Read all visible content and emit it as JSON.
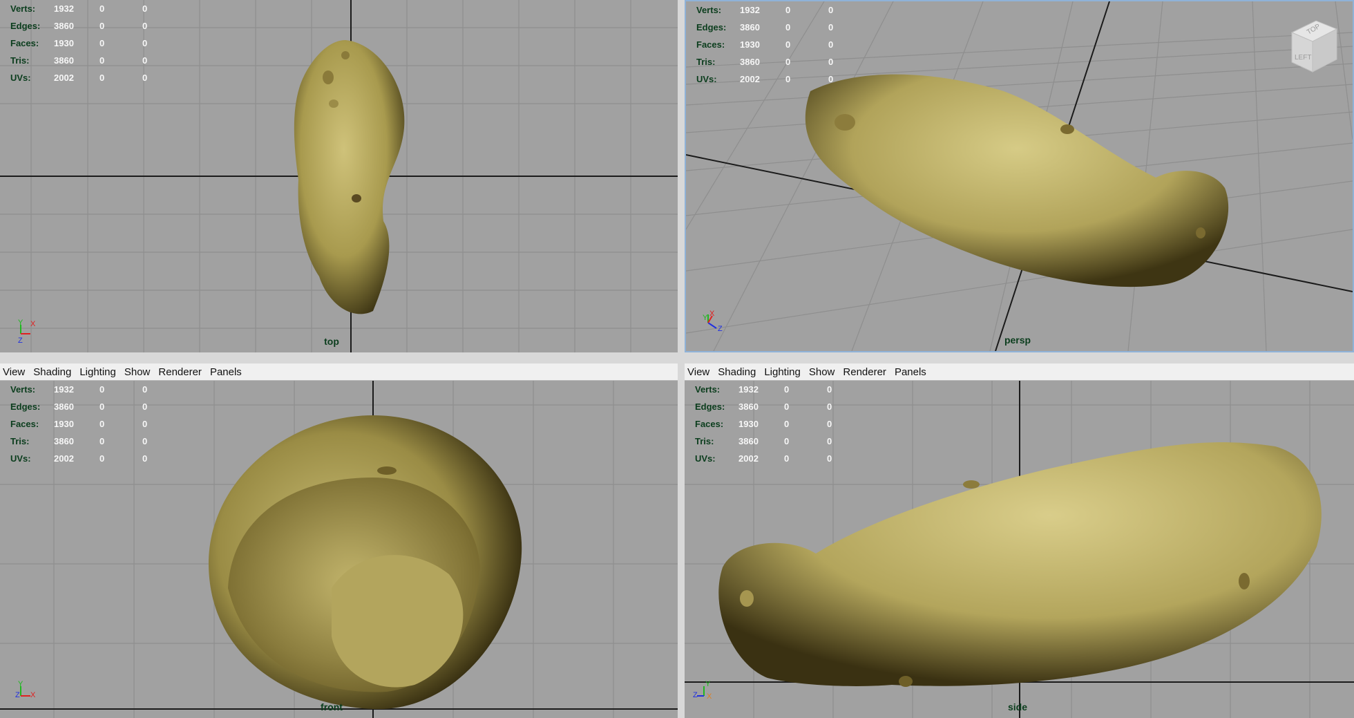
{
  "menu": [
    "View",
    "Shading",
    "Lighting",
    "Show",
    "Renderer",
    "Panels"
  ],
  "hud": {
    "rows": [
      {
        "label": "Verts:",
        "v1": "1932",
        "v2": "0",
        "v3": "0"
      },
      {
        "label": "Edges:",
        "v1": "3860",
        "v2": "0",
        "v3": "0"
      },
      {
        "label": "Faces:",
        "v1": "1930",
        "v2": "0",
        "v3": "0"
      },
      {
        "label": "Tris:",
        "v1": "3860",
        "v2": "0",
        "v3": "0"
      },
      {
        "label": "UVs:",
        "v1": "2002",
        "v2": "0",
        "v3": "0"
      }
    ]
  },
  "viewports": {
    "top": {
      "camera": "top",
      "axes": [
        "Y",
        "X",
        "Z"
      ]
    },
    "persp": {
      "camera": "persp",
      "axes": [
        "X",
        "Y",
        "Z"
      ]
    },
    "front": {
      "camera": "front",
      "axes": [
        "Y",
        "Z",
        "X"
      ]
    },
    "side": {
      "camera": "side",
      "axes": [
        "Y",
        "Z",
        "X"
      ]
    }
  },
  "viewcube": {
    "top": "TOP",
    "left": "LEFT"
  },
  "colors": {
    "viewport_bg": "#a1a1a1",
    "grid": "#8e8e8e",
    "axis_line": "#1a1a1a",
    "hud_label": "#0b3d1d",
    "hud_value": "#f7f7f7",
    "potato": "#b8aa5c"
  }
}
